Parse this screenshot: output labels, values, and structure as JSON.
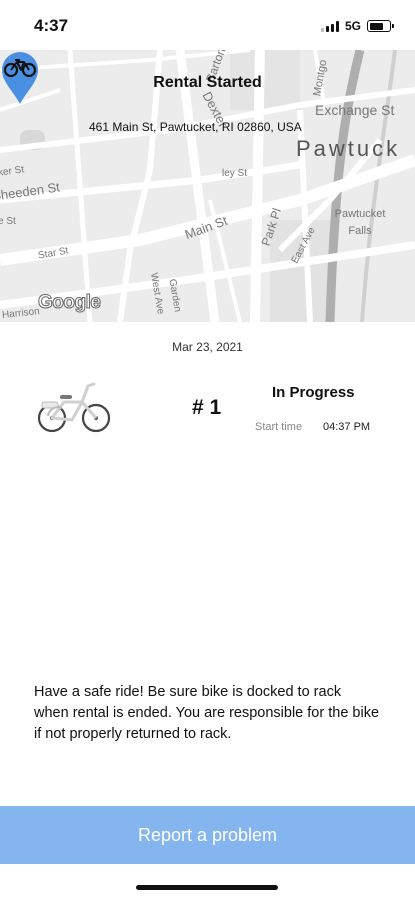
{
  "status_bar": {
    "time": "4:37",
    "network": "5G",
    "battery_level": 0.7
  },
  "header": {
    "back_icon": "arrow-left-icon",
    "title": "Rental Started"
  },
  "map": {
    "address": "461 Main St, Pawtucket, RI 02860, USA",
    "city_label": "Pawtuck",
    "labels": [
      "Barton",
      "Montgo",
      "Exchange St",
      "Dexter",
      "Sheeden St",
      "Main St",
      "Park Pl",
      "East Ave",
      "Pawtucket Falls",
      "Star St",
      "West Ave",
      "Garden",
      "Harrison",
      "ley St",
      "ker St",
      "e St"
    ],
    "pin_icon": "bike-pin-icon",
    "attribution": "Google",
    "pin_color": "#4a90e2"
  },
  "rental": {
    "date": "Mar 23, 2021",
    "bike_image": "bicycle-image",
    "number": "# 1",
    "status": "In Progress",
    "start_time_label": "Start time",
    "start_time_value": "04:37 PM"
  },
  "notice": {
    "text": "Have a safe ride! Be sure bike is docked to rack when rental is ended. You are responsible for the bike if not properly returned to rack."
  },
  "actions": {
    "report_label": "Report a problem",
    "report_color": "#85b5ef"
  }
}
